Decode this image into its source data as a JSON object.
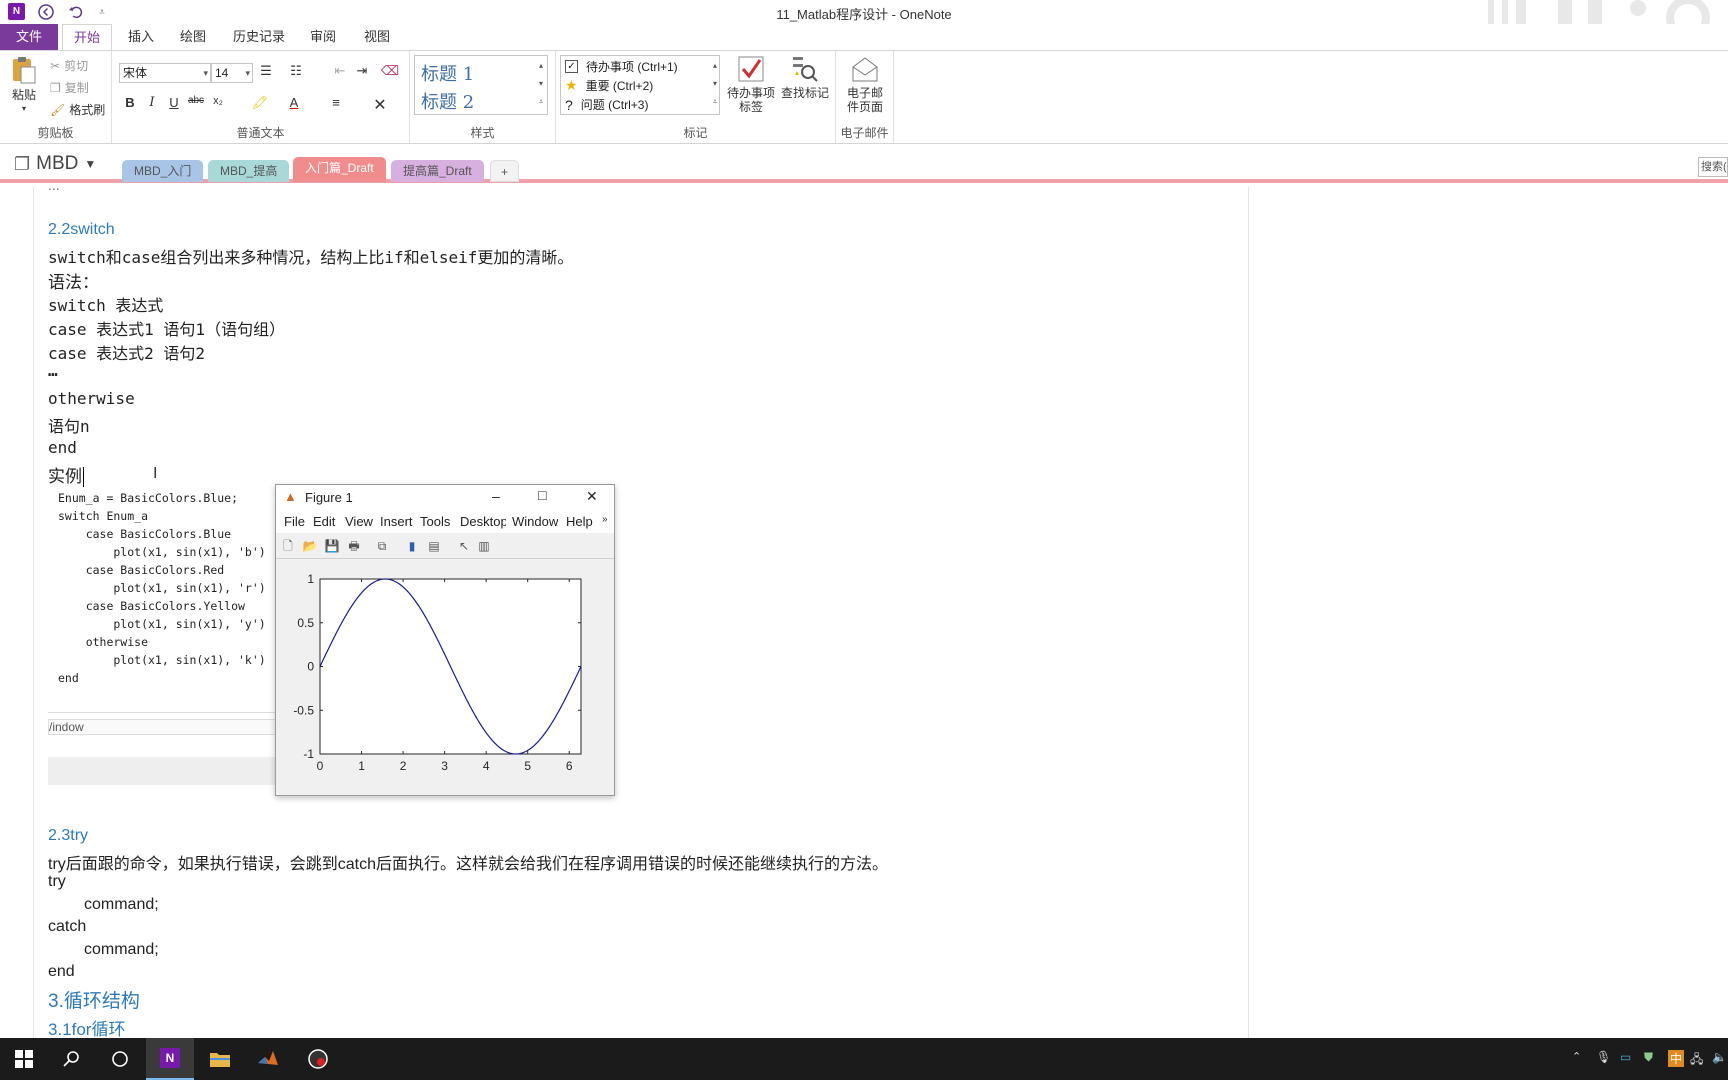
{
  "window": {
    "title": "11_Matlab程序设计 - OneNote"
  },
  "ribbon": {
    "tabs": [
      "文件",
      "开始",
      "插入",
      "绘图",
      "历史记录",
      "审阅",
      "视图"
    ],
    "clipboard": {
      "paste": "粘贴",
      "cut": "剪切",
      "copy": "复制",
      "format_painter": "格式刷",
      "label": "剪贴板"
    },
    "basic_text": {
      "font": "宋体",
      "size": "14",
      "label": "普通文本"
    },
    "styles": {
      "h1": "标题 1",
      "h2": "标题 2",
      "label": "样式"
    },
    "tags": {
      "items": [
        "待办事项 (Ctrl+1)",
        "重要 (Ctrl+2)",
        "问题 (Ctrl+3)"
      ],
      "todo_tag": "待办事项标签",
      "find_tags": "查找标记",
      "label": "标记"
    },
    "email": {
      "email_page": "电子邮件页面",
      "label": "电子邮件"
    }
  },
  "notebook": {
    "name": "MBD",
    "sections": [
      "MBD_入门",
      "MBD_提高",
      "入门篇_Draft",
      "提高篇_Draft"
    ],
    "add": "+",
    "search": "搜索("
  },
  "page": {
    "top_partial": "...",
    "h_switch": "2.2switch",
    "switch_desc": "switch和case组合列出来多种情况，结构上比if和elseif更加的清晰。",
    "syntax": "语法：",
    "syn1": "switch 表达式",
    "syn2": "case 表达式1 语句1（语句组）",
    "syn3": "case 表达式2 语句2",
    "syn4": "…",
    "syn5": "otherwise",
    "syn6": "语句n",
    "syn7": "end",
    "example": "实例",
    "code": [
      "Enum_a = BasicColors.Blue;",
      "switch Enum_a",
      "    case BasicColors.Blue",
      "        plot(x1, sin(x1), 'b')",
      "    case BasicColors.Red",
      "        plot(x1, sin(x1), 'r')",
      "    case BasicColors.Yellow",
      "        plot(x1, sin(x1), 'y')",
      "    otherwise",
      "        plot(x1, sin(x1), 'k')",
      "end"
    ],
    "window_label": "/indow",
    "h_try": "2.3try",
    "try_desc": "try后面跟的命令，如果执行错误，会跳到catch后面执行。这样就会给我们在程序调用错误的时候还能继续执行的方法。",
    "try_kw": "try",
    "try_cmd": "command;",
    "catch_kw": "catch",
    "catch_cmd": "command;",
    "end_kw": "end",
    "h_loop": "3.循环结构",
    "h_for": "3.1for循环"
  },
  "figure": {
    "title": "Figure 1",
    "menu": [
      "File",
      "Edit",
      "View",
      "Insert",
      "Tools",
      "Desktop",
      "Window",
      "Help"
    ],
    "minimize": "–",
    "maximize": "□",
    "close": "✕"
  },
  "chart_data": {
    "type": "line",
    "x_ticks": [
      0,
      1,
      2,
      3,
      4,
      5,
      6
    ],
    "y_ticks": [
      1,
      0.5,
      0,
      -0.5,
      -1
    ],
    "x_tick_labels": [
      "0",
      "1",
      "2",
      "3",
      "4",
      "5",
      "6"
    ],
    "y_tick_labels": [
      "1",
      "0.5",
      "0",
      "-0.5",
      "-1"
    ],
    "xlim": [
      0,
      6.2832
    ],
    "ylim": [
      -1,
      1
    ],
    "series": [
      {
        "function": "sin(x)",
        "color": "#1a1a8c"
      }
    ]
  },
  "taskbar": {
    "apps": [
      "windows-icon",
      "search-icon",
      "cortana-icon",
      "onenote-icon",
      "file-explorer-icon",
      "matlab-icon",
      "screen-recorder-icon"
    ],
    "ime": "中"
  }
}
